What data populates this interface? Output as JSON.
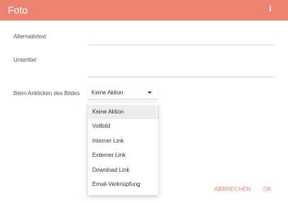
{
  "dialog": {
    "title": "Foto",
    "info_icon": "i"
  },
  "fields": {
    "alt_label": "Alternativtext",
    "alt_value": "",
    "caption_label": "Untertitel",
    "caption_value": "",
    "click_label": "Beim Anklicken des Bildes",
    "click_selected": "Keine Aktion"
  },
  "menu": {
    "items": [
      {
        "label": "Keine Aktion",
        "selected": true
      },
      {
        "label": "Vollbild",
        "selected": false
      },
      {
        "label": "Interner Link",
        "selected": false
      },
      {
        "label": "Externer Link",
        "selected": false
      },
      {
        "label": "Download Link",
        "selected": false
      },
      {
        "label": "Email-Verknüpfung",
        "selected": false
      }
    ]
  },
  "footer": {
    "cancel_label": "ABBRECHEN",
    "ok_label": "OK"
  },
  "colors": {
    "accent": "#ef8372"
  },
  "icons": {
    "info": "info-icon",
    "caret": "caret-down-icon"
  }
}
